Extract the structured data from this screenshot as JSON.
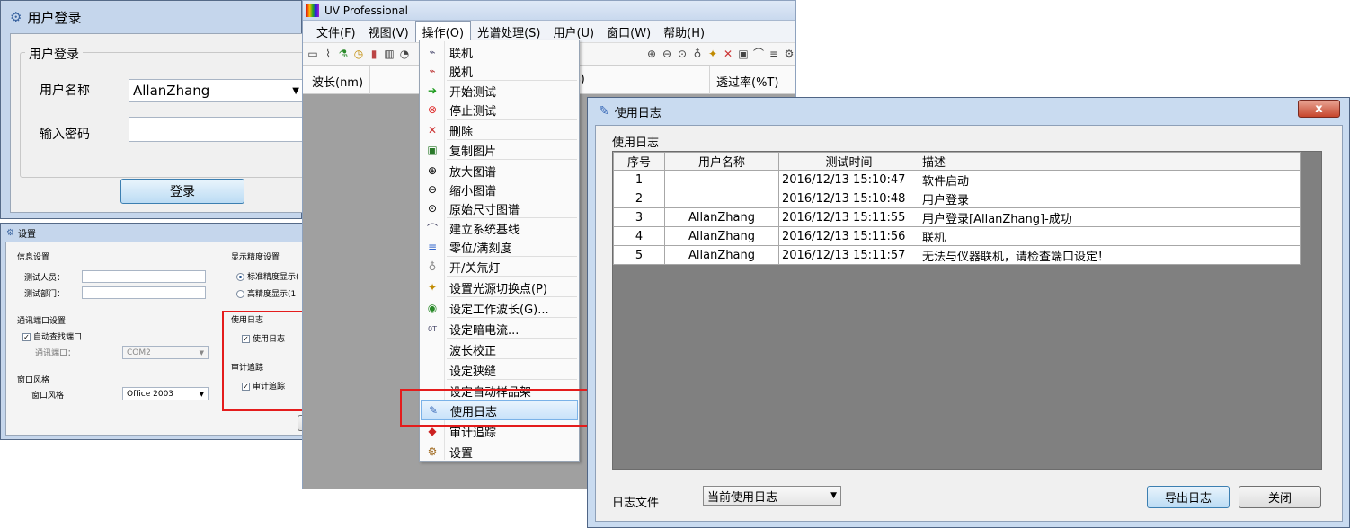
{
  "login": {
    "title": "用户登录",
    "group": "用户登录",
    "username_label": "用户名称",
    "username_value": "AllanZhang",
    "password_label": "输入密码",
    "password_value": "",
    "login_button": "登录"
  },
  "settings": {
    "title": "设置",
    "info_group": "信息设置",
    "tester_label": "测试人员：",
    "dept_label": "测试部门：",
    "precision_group": "显示精度设置",
    "precision_standard": "标准精度显示(",
    "precision_high": "高精度显示(1",
    "comm_group": "通讯端口设置",
    "auto_find_port": "自动查找端口",
    "port_label": "通讯端口：",
    "port_value": "COM2",
    "style_group": "窗口风格",
    "style_label": "窗口风格",
    "style_value": "Office 2003",
    "log_group": "使用日志",
    "use_log": "使用日志",
    "audit_group": "审计追踪",
    "audit_trail": "审计追踪"
  },
  "uv": {
    "title": "UV Professional",
    "menus": [
      "文件(F)",
      "视图(V)",
      "操作(O)",
      "光谱处理(S)",
      "用户(U)",
      "窗口(W)",
      "帮助(H)"
    ],
    "col_wavelength": "波长(nm)",
    "col_partial": "s)",
    "col_transmittance": "透过率(%T)"
  },
  "operate_menu": {
    "items": [
      {
        "label": "联机",
        "icon": "connect-icon"
      },
      {
        "label": "脱机",
        "icon": "disconnect-icon"
      },
      {
        "label": "开始测试",
        "icon": "start-icon"
      },
      {
        "label": "停止测试",
        "icon": "stop-icon"
      },
      {
        "label": "删除",
        "icon": "delete-icon"
      },
      {
        "label": "复制图片",
        "icon": "copy-image-icon"
      },
      {
        "label": "放大图谱",
        "icon": "zoom-in-icon"
      },
      {
        "label": "缩小图谱",
        "icon": "zoom-out-icon"
      },
      {
        "label": "原始尺寸图谱",
        "icon": "zoom-reset-icon"
      },
      {
        "label": "建立系统基线",
        "icon": "baseline-icon"
      },
      {
        "label": "零位/满刻度",
        "icon": "zero-icon"
      },
      {
        "label": "开/关氘灯",
        "icon": "lamp-icon"
      },
      {
        "label": "设置光源切换点(P)",
        "icon": "light-switch-icon"
      },
      {
        "label": "设定工作波长(G)...",
        "icon": "wavelength-icon"
      },
      {
        "label": "设定暗电流...",
        "icon": "dark-current-icon"
      },
      {
        "label": "波长校正",
        "icon": "blank-icon"
      },
      {
        "label": "设定狭缝",
        "icon": "blank-icon"
      },
      {
        "label": "设定自动样品架",
        "icon": "blank-icon"
      },
      {
        "label": "使用日志",
        "icon": "log-icon"
      },
      {
        "label": "审计追踪",
        "icon": "audit-icon"
      },
      {
        "label": "设置",
        "icon": "settings-icon"
      }
    ]
  },
  "log": {
    "title": "使用日志",
    "group": "使用日志",
    "columns": [
      "序号",
      "用户名称",
      "测试时间",
      "描述"
    ],
    "rows": [
      [
        "1",
        "",
        "2016/12/13 15:10:47",
        "软件启动"
      ],
      [
        "2",
        "",
        "2016/12/13 15:10:48",
        "用户登录"
      ],
      [
        "3",
        "AllanZhang",
        "2016/12/13 15:11:55",
        "用户登录[AllanZhang]-成功"
      ],
      [
        "4",
        "AllanZhang",
        "2016/12/13 15:11:56",
        "联机"
      ],
      [
        "5",
        "AllanZhang",
        "2016/12/13 15:11:57",
        "无法与仪器联机，请检查端口设定！"
      ]
    ],
    "file_label": "日志文件",
    "file_value": "当前使用日志",
    "export_button": "导出日志",
    "close_button": "关闭",
    "close_x": "x"
  }
}
